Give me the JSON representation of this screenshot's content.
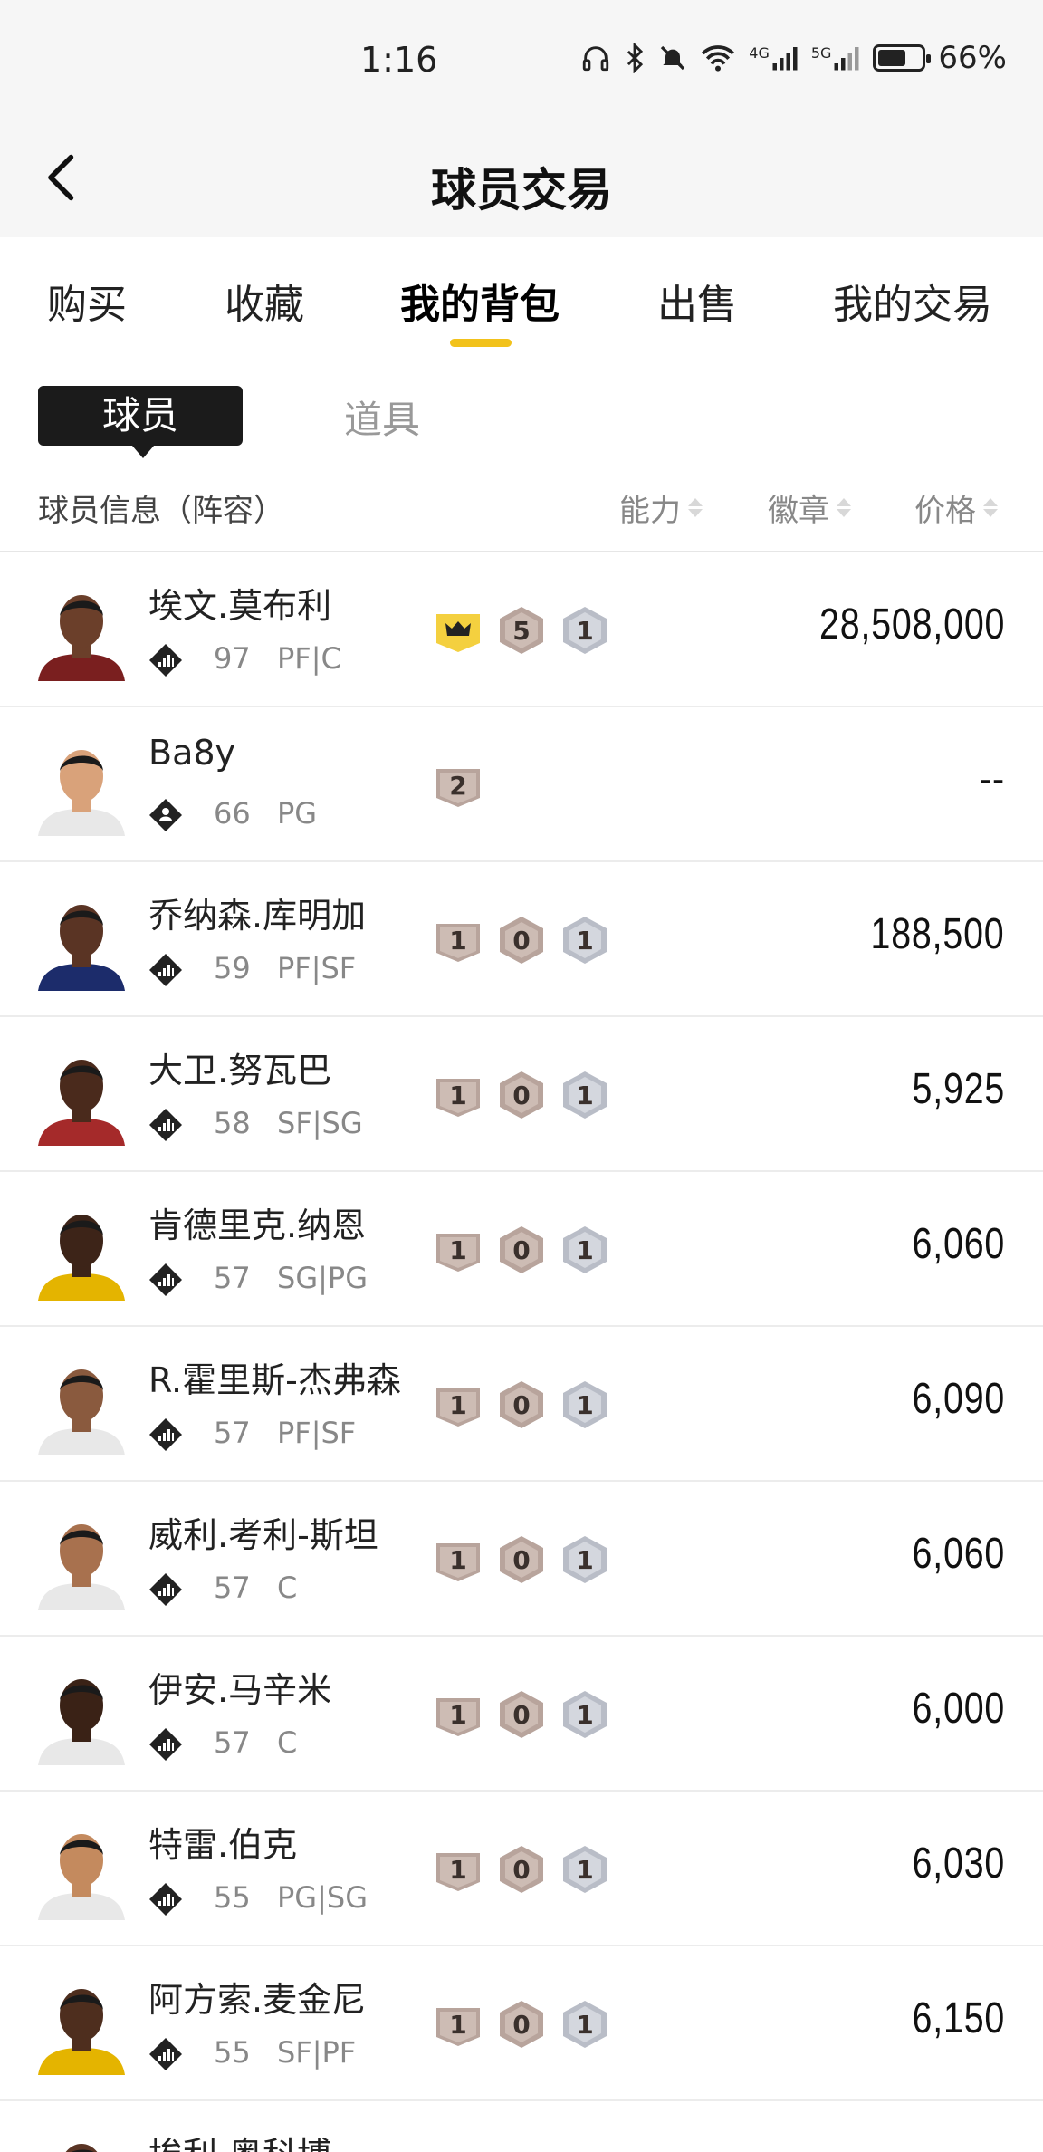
{
  "status_bar": {
    "time": "1:16",
    "battery": "66%",
    "network_4g": "4G",
    "network_5g": "5G",
    "battery_level": 0.66
  },
  "header": {
    "title": "球员交易"
  },
  "tabs": [
    {
      "label": "购买"
    },
    {
      "label": "收藏"
    },
    {
      "label": "我的背包",
      "active": true
    },
    {
      "label": "出售"
    },
    {
      "label": "我的交易"
    }
  ],
  "segments": {
    "player": "球员",
    "item": "道具"
  },
  "columns": {
    "info": "球员信息（阵容）",
    "ability": "能力",
    "badge": "徽章",
    "price": "价格"
  },
  "players": [
    {
      "name": "埃文.莫布利",
      "ovr": "97",
      "pos": "PF|C",
      "badges": [
        "crown",
        "5",
        "1"
      ],
      "price": "28,508,000",
      "rank_icon": "bars-icon"
    },
    {
      "name": "Ba8y",
      "ovr": "66",
      "pos": "PG",
      "badges": [
        "2"
      ],
      "price": "--",
      "rank_icon": "user-icon"
    },
    {
      "name": "乔纳森.库明加",
      "ovr": "59",
      "pos": "PF|SF",
      "badges": [
        "1",
        "0",
        "1"
      ],
      "price": "188,500",
      "rank_icon": "bars-icon"
    },
    {
      "name": "大卫.努瓦巴",
      "ovr": "58",
      "pos": "SF|SG",
      "badges": [
        "1",
        "0",
        "1"
      ],
      "price": "5,925",
      "rank_icon": "bars-icon"
    },
    {
      "name": "肯德里克.纳恩",
      "ovr": "57",
      "pos": "SG|PG",
      "badges": [
        "1",
        "0",
        "1"
      ],
      "price": "6,060",
      "rank_icon": "bars-icon"
    },
    {
      "name": "R.霍里斯-杰弗森",
      "ovr": "57",
      "pos": "PF|SF",
      "badges": [
        "1",
        "0",
        "1"
      ],
      "price": "6,090",
      "rank_icon": "bars-icon"
    },
    {
      "name": "威利.考利-斯坦",
      "ovr": "57",
      "pos": "C",
      "badges": [
        "1",
        "0",
        "1"
      ],
      "price": "6,060",
      "rank_icon": "bars-icon"
    },
    {
      "name": "伊安.马辛米",
      "ovr": "57",
      "pos": "C",
      "badges": [
        "1",
        "0",
        "1"
      ],
      "price": "6,000",
      "rank_icon": "bars-icon"
    },
    {
      "name": "特雷.伯克",
      "ovr": "55",
      "pos": "PG|SG",
      "badges": [
        "1",
        "0",
        "1"
      ],
      "price": "6,030",
      "rank_icon": "bars-icon"
    },
    {
      "name": "阿方索.麦金尼",
      "ovr": "55",
      "pos": "SF|PF",
      "badges": [
        "1",
        "0",
        "1"
      ],
      "price": "6,150",
      "rank_icon": "bars-icon"
    },
    {
      "name": "埃利.奥科博",
      "ovr": "",
      "pos": "",
      "badges": [],
      "price": "",
      "rank_icon": "bars-icon"
    }
  ],
  "colors": {
    "accent": "#f2c21b",
    "badge_bronze": "#b8a49c",
    "badge_silver": "#b9bdc7",
    "badge_gold": "#f4d03f"
  }
}
